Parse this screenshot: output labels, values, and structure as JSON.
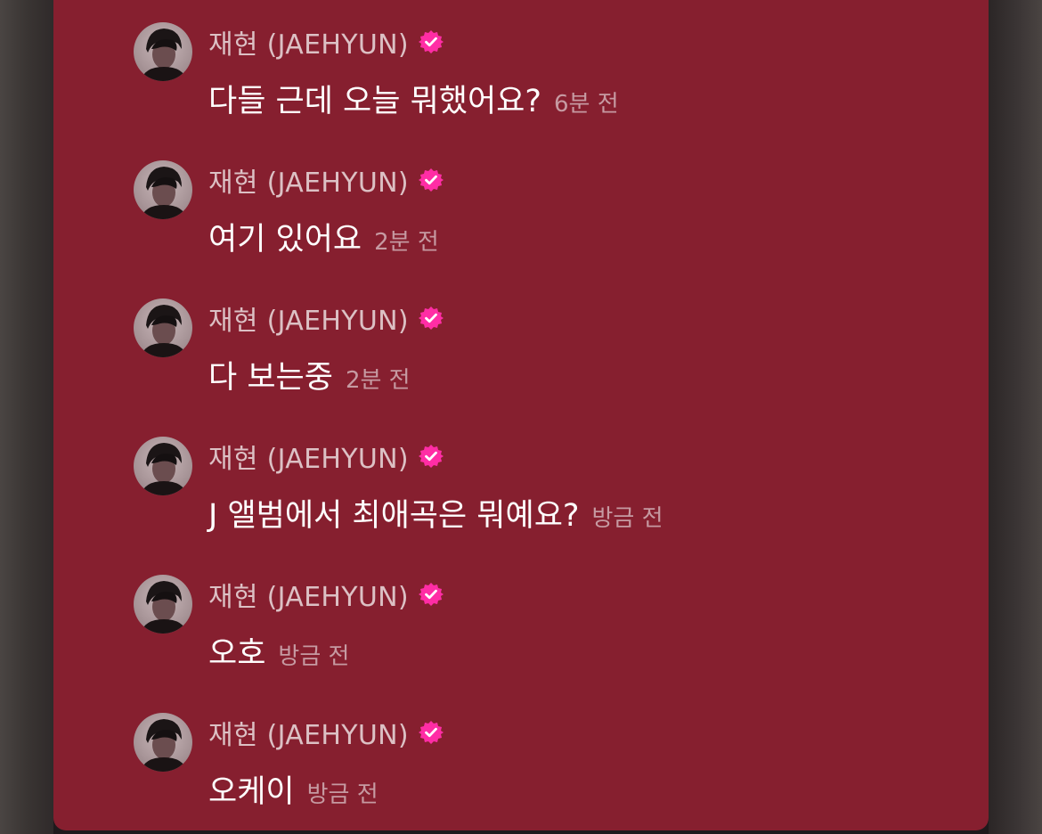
{
  "colors": {
    "panel_background": "#861f2f",
    "name_text": "#dcc0c4",
    "message_text": "#ffffff",
    "timestamp_text": "#c69aa2",
    "verified_badge": "#ff2da5"
  },
  "icons": {
    "verified": "verified-badge-icon",
    "avatar": "profile-avatar"
  },
  "messages": [
    {
      "sender": "재현 (JAEHYUN)",
      "text": "다들 근데 오늘 뭐했어요?",
      "time": "6분 전"
    },
    {
      "sender": "재현 (JAEHYUN)",
      "text": "여기 있어요",
      "time": "2분 전"
    },
    {
      "sender": "재현 (JAEHYUN)",
      "text": "다 보는중",
      "time": "2분 전"
    },
    {
      "sender": "재현 (JAEHYUN)",
      "text": "J 앨범에서 최애곡은 뭐예요?",
      "time": "방금 전"
    },
    {
      "sender": "재현 (JAEHYUN)",
      "text": "오호",
      "time": "방금 전"
    },
    {
      "sender": "재현 (JAEHYUN)",
      "text": "오케이",
      "time": "방금 전"
    }
  ]
}
